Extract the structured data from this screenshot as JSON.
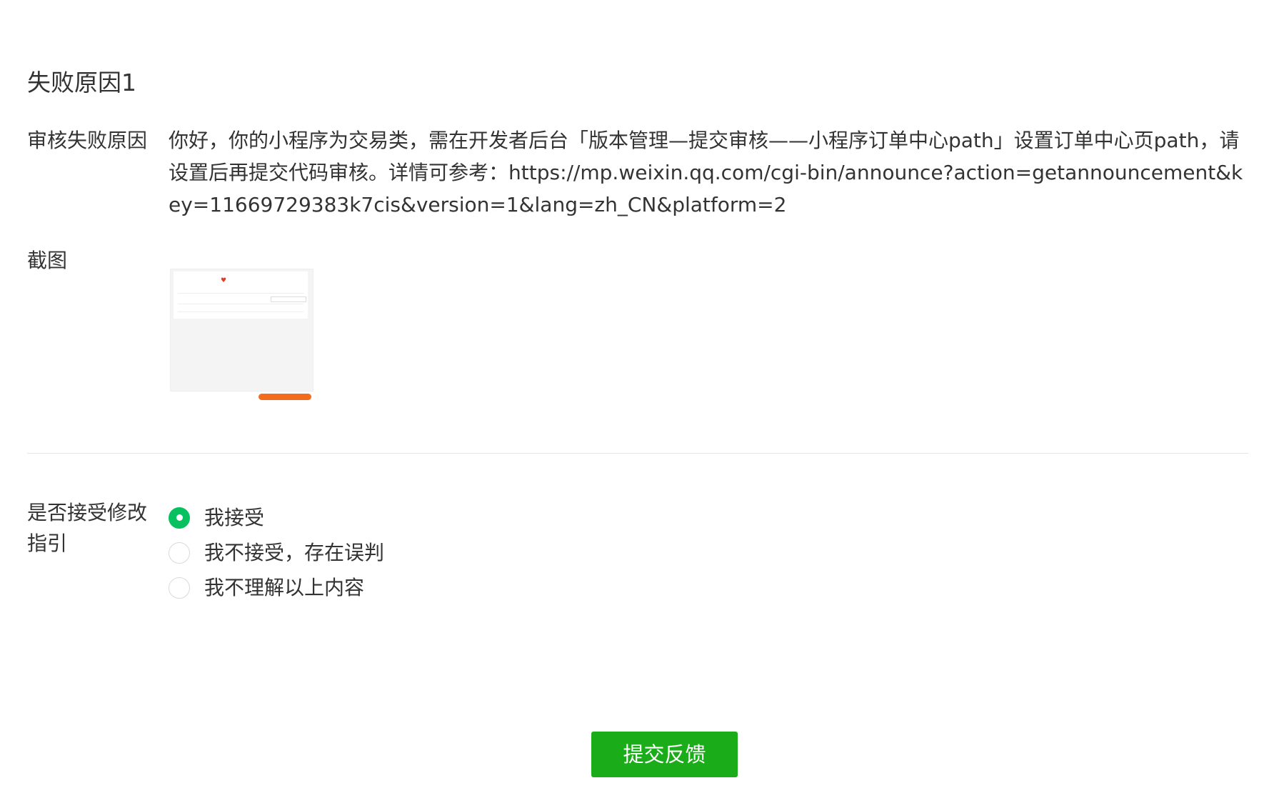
{
  "section_title": "失败原因1",
  "reason": {
    "label": "审核失败原因",
    "text": "你好，你的小程序为交易类，需在开发者后台「版本管理—提交审核——小程序订单中心path」设置订单中心页path，请设置后再提交代码审核。详情可参考：https://mp.weixin.qq.com/cgi-bin/announce?action=getannouncement&key=11669729383k7cis&version=1&lang=zh_CN&platform=2"
  },
  "screenshot": {
    "label": "截图"
  },
  "accept": {
    "label": "是否接受修改指引",
    "options": [
      {
        "label": "我接受",
        "checked": true
      },
      {
        "label": "我不接受，存在误判",
        "checked": false
      },
      {
        "label": "我不理解以上内容",
        "checked": false
      }
    ]
  },
  "submit_label": "提交反馈",
  "colors": {
    "accent_green": "#07c160",
    "button_green": "#1aad19",
    "text": "#333333",
    "divider": "#e5e5e5"
  }
}
